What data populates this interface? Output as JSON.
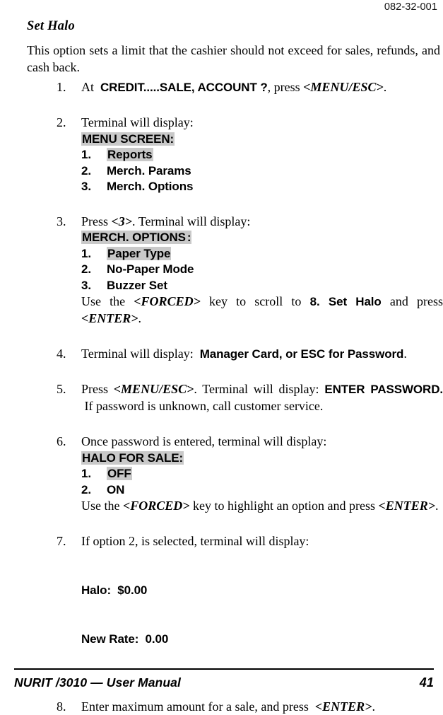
{
  "header": {
    "doc_number": "082-32-001"
  },
  "section": {
    "title": "Set Halo",
    "intro": "This option sets a limit that the cashier should not exceed for sales, refunds, and cash back."
  },
  "steps": {
    "s1": {
      "num": "1.",
      "lead": "At",
      "screen_prompt": "CREDIT.....SALE, ACCOUNT ?",
      "mid": ", press",
      "key": "<MENU/ESC>",
      "tail": "."
    },
    "s2": {
      "num": "2.",
      "lead": "Terminal will display:",
      "screen_title": "MENU SCREEN:",
      "rows": [
        {
          "idx": "1.",
          "label": "Reports",
          "highlight": true
        },
        {
          "idx": "2.",
          "label": "Merch. Params",
          "highlight": false
        },
        {
          "idx": "3.",
          "label": "Merch. Options",
          "highlight": false
        }
      ]
    },
    "s3": {
      "num": "3.",
      "lead": "Press",
      "key": "<3>",
      "lead2": ". Terminal will display:",
      "screen_title": "MERCH. OPTIONS",
      "screen_title_colon": ":",
      "rows": [
        {
          "idx": "1.",
          "label": "Paper Type",
          "highlight": true
        },
        {
          "idx": "2.",
          "label": "No-Paper Mode",
          "highlight": false
        },
        {
          "idx": "3.",
          "label": "Buzzer Set",
          "highlight": false
        }
      ],
      "note_a": "Use the",
      "note_key1": "<FORCED>",
      "note_b": "key to scroll to",
      "note_target": "8. Set Halo",
      "note_c": "and press",
      "note_key2": "<ENTER>",
      "note_d": "."
    },
    "s4": {
      "num": "4.",
      "lead": "Terminal will display:",
      "screen_prompt": "Manager Card, or ESC for Password",
      "tail": "."
    },
    "s5": {
      "num": "5.",
      "lead": "Press",
      "key": "<MENU/ESC>",
      "mid": ". Terminal will display:",
      "screen_prompt": "ENTER PASSWORD.",
      "tail": "If password is unknown, call customer service."
    },
    "s6": {
      "num": "6.",
      "lead": "Once password is entered, terminal will display:",
      "screen_title": "HALO FOR SALE:",
      "rows": [
        {
          "idx": "1.",
          "label": "OFF",
          "highlight": true
        },
        {
          "idx": "2.",
          "label": "ON",
          "highlight": false
        }
      ],
      "note_a": "Use the",
      "note_key1": "<FORCED>",
      "note_b": "key to highlight an option and press",
      "note_key2": "<ENTER>",
      "note_c": "."
    },
    "s7": {
      "num": "7.",
      "lead": "If  option 2, is selected, terminal will display:",
      "line1": "Halo:  $0.00",
      "line2": "New Rate:  0.00"
    },
    "s8": {
      "num": "8.",
      "lead": "Enter maximum amount for a sale, and press",
      "key": "<ENTER>",
      "tail": "."
    }
  },
  "footer": {
    "manual_title": "NURIT /3010 — User Manual",
    "page_number": "41"
  },
  "colors": {
    "highlight": "#c9c9c9",
    "text": "#000000",
    "background": "#ffffff"
  }
}
